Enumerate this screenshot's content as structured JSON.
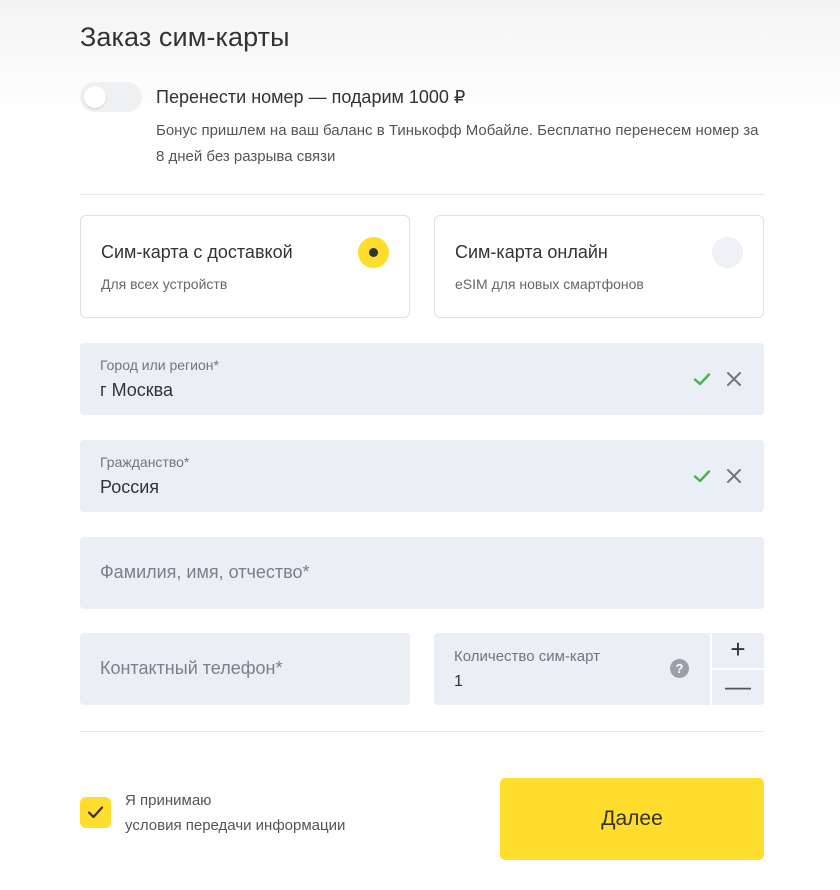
{
  "header": {
    "title": "Заказ сим-карты"
  },
  "number_transfer": {
    "toggle_on": false,
    "title": "Перенести номер — подарим 1000 ₽",
    "description": "Бонус пришлем на ваш баланс в Тинькофф Мобайле. Бесплатно перенесем номер за 8 дней без разрыва связи"
  },
  "sim_options": [
    {
      "title": "Сим-карта с доставкой",
      "subtitle": "Для всех устройств",
      "selected": true
    },
    {
      "title": "Сим-карта онлайн",
      "subtitle": "eSIM для новых смартфонов",
      "selected": false
    }
  ],
  "fields": {
    "city": {
      "label": "Город или регион*",
      "value": "г Москва"
    },
    "citizenship": {
      "label": "Гражданство*",
      "value": "Россия"
    },
    "full_name": {
      "placeholder": "Фамилия, имя, отчество*"
    },
    "phone": {
      "placeholder": "Контактный телефон*"
    },
    "sim_count": {
      "label": "Количество сим-карт",
      "value": "1",
      "help_icon": "?"
    }
  },
  "stepper": {
    "plus": "+",
    "minus": "—"
  },
  "consent": {
    "checked": true,
    "line1": "Я принимаю",
    "line2": "условия передачи информации"
  },
  "submit": {
    "label": "Далее"
  },
  "colors": {
    "accent": "#ffdd2d",
    "field_bg": "#eaeef5",
    "check_green": "#4caf50",
    "text": "#333333"
  }
}
